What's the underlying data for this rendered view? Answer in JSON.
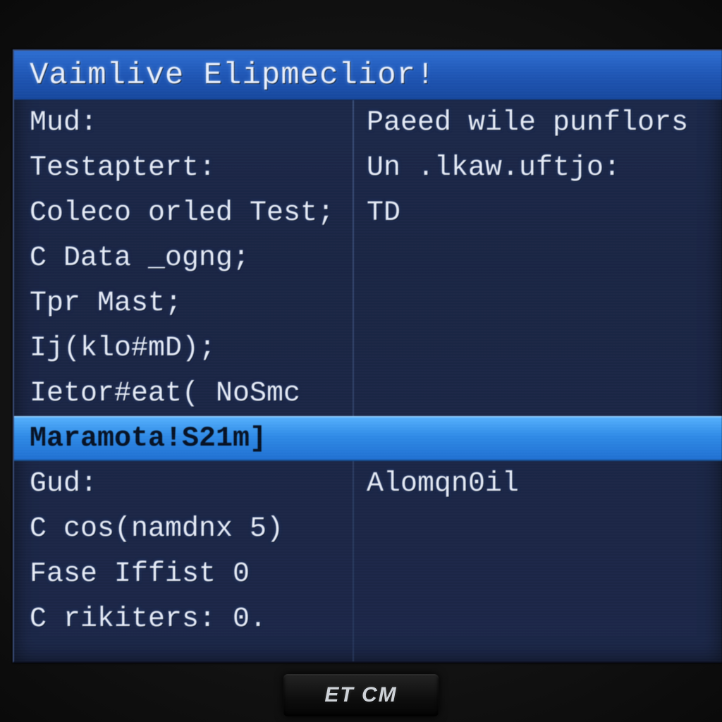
{
  "title": "Vaimlive Elipmeclior!",
  "rows": [
    {
      "left": "Mud:",
      "right": "Paeed wile punflors",
      "selected": false
    },
    {
      "left": "Testaptert:",
      "right": "Un .lkaw.uftjo:",
      "selected": false
    },
    {
      "left": "Coleco orled Test;",
      "right": "TD",
      "selected": false
    },
    {
      "left": "C Data _ogng;",
      "right": "",
      "selected": false
    },
    {
      "left": "Tpr Mast;",
      "right": "",
      "selected": false
    },
    {
      "left": "Ij(klo#mD);",
      "right": "",
      "selected": false
    },
    {
      "left": "Ietor#eat( NoSmc",
      "right": "",
      "selected": false
    },
    {
      "left": "Maramota!S21m]",
      "right": "",
      "selected": true
    },
    {
      "left": "Gud:",
      "right": "Alomqn0il",
      "selected": false
    },
    {
      "left": "C cos(namdnx 5)",
      "right": "",
      "selected": false
    },
    {
      "left": "Fase Iffist 0",
      "right": "",
      "selected": false
    },
    {
      "left": "C rikiters: 0.",
      "right": "",
      "selected": false
    }
  ],
  "bezel_brand": "ET CM"
}
